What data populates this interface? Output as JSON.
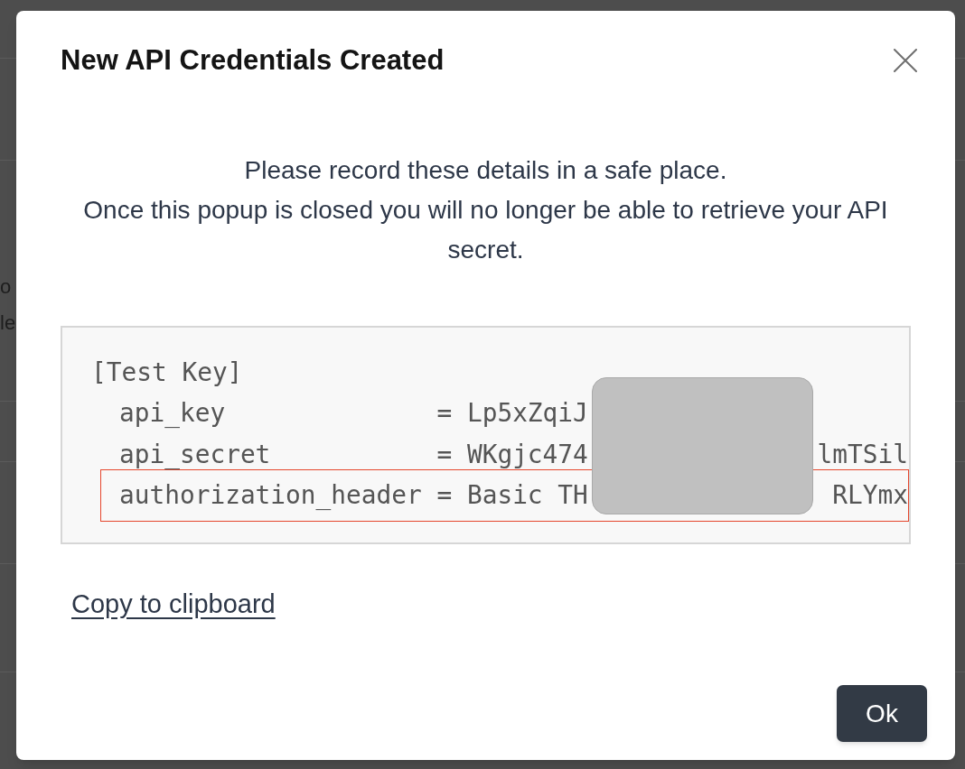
{
  "background_page": {
    "lines": [
      "o",
      "le"
    ]
  },
  "dialog": {
    "title": "New API Credentials Created",
    "message_lines": [
      "Please record these details in a safe place.",
      "Once this popup is closed you will no longer be able to retrieve your API secret."
    ],
    "code_block": {
      "section": "[Test Key]",
      "entries": [
        {
          "key": "api_key",
          "separator": "=",
          "value_start": "Lp5xZqiJ",
          "highlighted": false
        },
        {
          "key": "api_secret",
          "separator": "=",
          "value_start": "WKgjc474",
          "value_end": "lmTSil",
          "highlighted": false
        },
        {
          "key": "authorization_header",
          "separator": "=",
          "value_start": "Basic TH",
          "value_end": "RLYmx",
          "highlighted": true
        }
      ]
    },
    "copy_link": "Copy to clipboard",
    "confirm_button": "Ok"
  }
}
